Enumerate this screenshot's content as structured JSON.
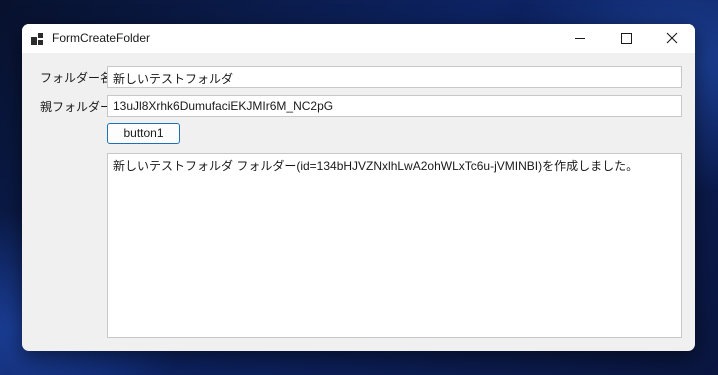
{
  "window": {
    "title": "FormCreateFolder",
    "accent_color": "#1f6fb5"
  },
  "titlebar_icons": {
    "app": "app-window-icon",
    "minimize": "minimize-icon",
    "maximize": "maximize-icon",
    "close": "close-icon"
  },
  "form": {
    "folder_name_label": "フォルダー名",
    "folder_name_value": "新しいテストフォルダ",
    "parent_folder_label": "親フォルダー",
    "parent_folder_value": "13uJl8Xrhk6DumufaciEKJMIr6M_NC2pG",
    "button_label": "button1",
    "output_text": "新しいテストフォルダ フォルダー(id=134bHJVZNxlhLwA2ohWLxTc6u-jVMINBI)を作成しました。"
  }
}
